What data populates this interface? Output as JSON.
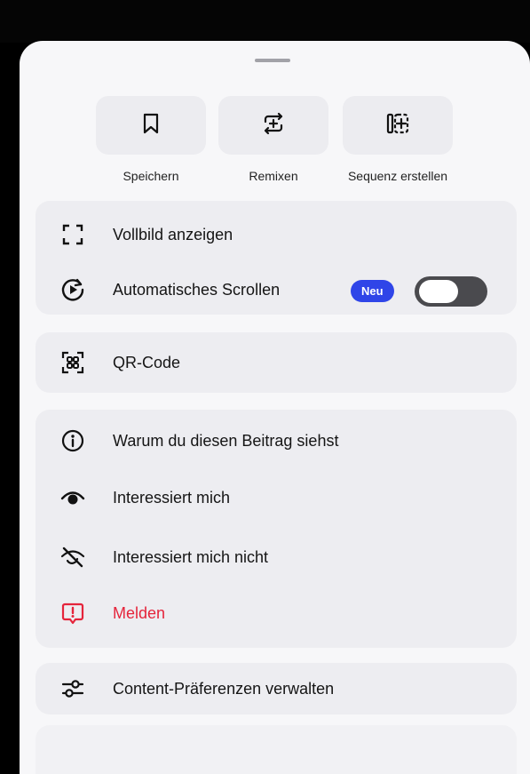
{
  "actions": {
    "save_label": "Speichern",
    "remix_label": "Remixen",
    "sequence_label": "Sequenz erstellen"
  },
  "menu": {
    "fullscreen_label": "Vollbild anzeigen",
    "autoscroll_label": "Automatisches Scrollen",
    "autoscroll_badge": "Neu",
    "autoscroll_enabled": false,
    "qr_label": "QR-Code",
    "why_label": "Warum du diesen Beitrag siehst",
    "interested_label": "Interessiert mich",
    "not_interested_label": "Interessiert mich nicht",
    "report_label": "Melden",
    "preferences_label": "Content-Präferenzen verwalten"
  },
  "colors": {
    "badge": "#2f45e8",
    "report": "#e5243b",
    "toggle_off": "#4a4a4e"
  }
}
